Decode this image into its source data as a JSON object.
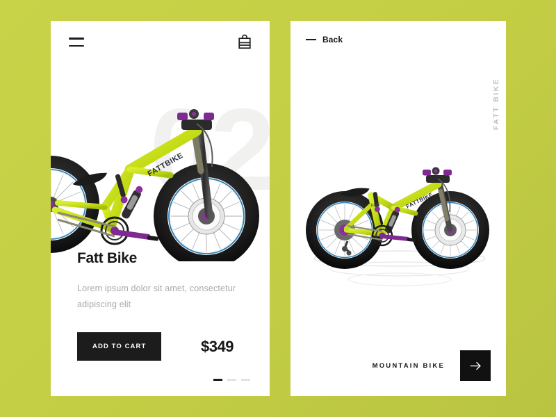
{
  "theme": {
    "background_start": "#c9d348",
    "background_end": "#b9c441",
    "card_background": "#ffffff",
    "accent_dark": "#1c1c1c",
    "bike_green": "#cbe022",
    "watermark_color": "#f1f1ef",
    "muted_text": "#a8a8a8"
  },
  "left_card": {
    "header": {
      "menu_icon": "hamburger-icon",
      "bag_icon": "shopping-bag-icon"
    },
    "watermark": "02",
    "product": {
      "title": "Fatt Bike",
      "description": "Lorem ipsum dolor sit amet, consectetur adipiscing elit",
      "price": "$349",
      "cta_label": "ADD TO CART"
    },
    "pagination": {
      "active_index": 0,
      "dots": [
        {
          "active": true
        },
        {
          "active": false
        },
        {
          "active": false
        }
      ]
    }
  },
  "right_card": {
    "back": {
      "label": "Back",
      "icon": "dash-icon"
    },
    "vertical_title": "FATT BIKE",
    "footer": {
      "category_label": "MOUNTAIN BIKE",
      "next_icon": "arrow-right-icon"
    }
  }
}
